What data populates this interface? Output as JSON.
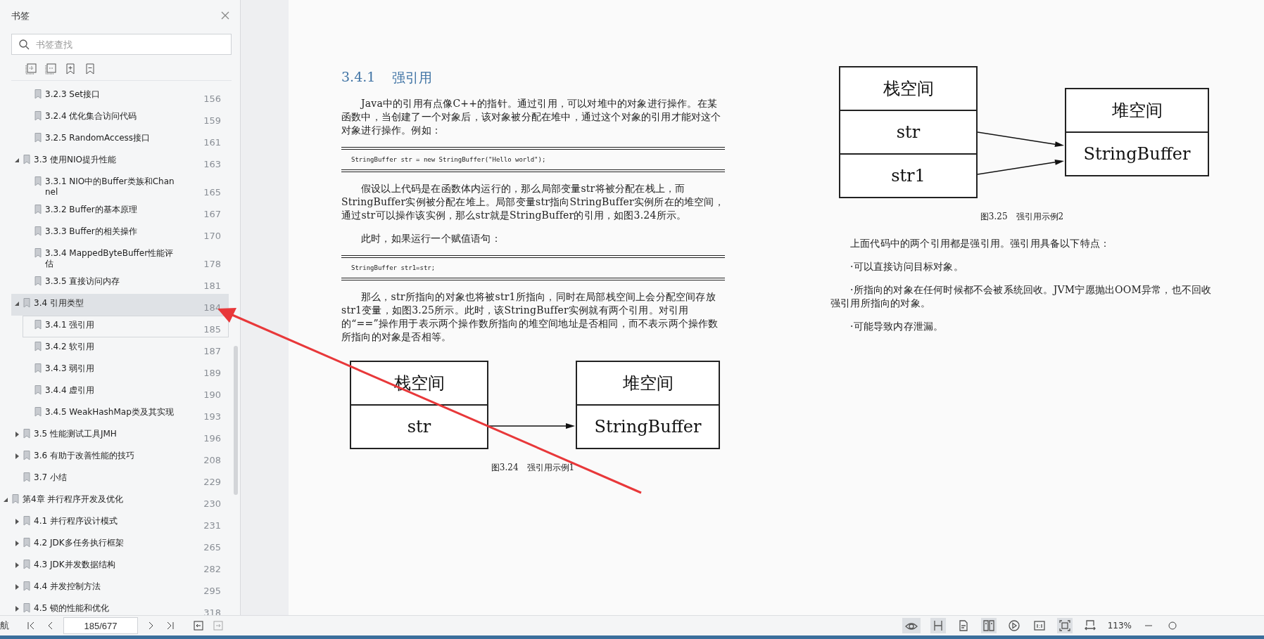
{
  "sidebar": {
    "title": "书签",
    "search": {
      "placeholder": "书签查找"
    },
    "tree": [
      {
        "children": [
          {
            "children": [
              {
                "label": "3.2.3 Set接口",
                "page": "156",
                "selected": false,
                "focused": false
              },
              {
                "label": "3.2.4 优化集合访问代码",
                "page": "159",
                "selected": false,
                "focused": false
              },
              {
                "label": "3.2.5 RandomAccess接口",
                "page": "161",
                "selected": false,
                "focused": false
              }
            ]
          },
          {
            "label": "3.3 使用NIO提升性能",
            "page": "163",
            "expanded": true,
            "selected": false,
            "focused": false,
            "children": [
              {
                "label": "3.3.1 NIO中的Buffer类族和Channel",
                "page": "165",
                "selected": false,
                "focused": false
              },
              {
                "label": "3.3.2 Buffer的基本原理",
                "page": "167",
                "selected": false,
                "focused": false
              },
              {
                "label": "3.3.3 Buffer的相关操作",
                "page": "170",
                "selected": false,
                "focused": false
              },
              {
                "label": "3.3.4 MappedByteBuffer性能评估",
                "page": "178",
                "selected": false,
                "focused": false
              },
              {
                "label": "3.3.5 直接访问内存",
                "page": "181",
                "selected": false,
                "focused": false
              }
            ]
          },
          {
            "label": "3.4 引用类型",
            "page": "184",
            "expanded": true,
            "selected": true,
            "focused": false,
            "children": [
              {
                "label": "3.4.1 强引用",
                "page": "185",
                "selected": false,
                "focused": true
              },
              {
                "label": "3.4.2 软引用",
                "page": "187",
                "selected": false,
                "focused": false
              },
              {
                "label": "3.4.3 弱引用",
                "page": "189",
                "selected": false,
                "focused": false
              },
              {
                "label": "3.4.4 虚引用",
                "page": "190",
                "selected": false,
                "focused": false
              },
              {
                "label": "3.4.5 WeakHashMap类及其实现",
                "page": "193",
                "selected": false,
                "focused": false
              }
            ]
          },
          {
            "label": "3.5 性能测试工具JMH",
            "page": "196",
            "expanded": false,
            "selected": false,
            "focused": false
          },
          {
            "label": "3.6 有助于改善性能的技巧",
            "page": "208",
            "expanded": false,
            "selected": false,
            "focused": false
          },
          {
            "label": "3.7 小结",
            "page": "229",
            "selected": false,
            "focused": false
          }
        ]
      },
      {
        "label": "第4章 并行程序开发及优化",
        "page": "230",
        "expanded": true,
        "selected": false,
        "focused": false,
        "children": [
          {
            "label": "4.1 并行程序设计模式",
            "page": "231",
            "expanded": false,
            "selected": false,
            "focused": false
          },
          {
            "label": "4.2 JDK多任务执行框架",
            "page": "265",
            "expanded": false,
            "selected": false,
            "focused": false
          },
          {
            "label": "4.3 JDK并发数据结构",
            "page": "282",
            "expanded": false,
            "selected": false,
            "focused": false
          },
          {
            "label": "4.4 并发控制方法",
            "page": "295",
            "expanded": false,
            "selected": false,
            "focused": false
          },
          {
            "label": "4.5 锁的性能和优化",
            "page": "318",
            "expanded": false,
            "selected": false,
            "focused": false
          }
        ]
      }
    ]
  },
  "pages": [
    [
      {
        "kind": "heading",
        "number": "3.4.1",
        "text": "强引用"
      },
      {
        "kind": "para",
        "text": "Java中的引用有点像C++的指针。通过引用，可以对堆中的对象进行操作。在某函数中，当创建了一个对象后，该对象被分配在堆中，通过这个对象的引用才能对这个对象进行操作。例如："
      },
      {
        "kind": "code",
        "text": "StringBuffer str = new StringBuffer(\"Hello world\");"
      },
      {
        "kind": "para",
        "text": "假设以上代码是在函数体内运行的，那么局部变量str将被分配在栈上，而StringBuffer实例被分配在堆上。局部变量str指向StringBuffer实例所在的堆空间，通过str可以操作该实例，那么str就是StringBuffer的引用，如图3.24所示。"
      },
      {
        "kind": "para",
        "text": "此时，如果运行一个赋值语句："
      },
      {
        "kind": "code",
        "text": "StringBuffer str1=str;"
      },
      {
        "kind": "para",
        "text": "那么，str所指向的对象也将被str1所指向，同时在局部栈空间上会分配空间存放str1变量，如图3.25所示。此时，该StringBuffer实例就有两个引用。对引用的“==”操作用于表示两个操作数所指向的堆空间地址是否相同，而不表示两个操作数所指向的对象是否相等。"
      },
      {
        "kind": "figure",
        "stack": {
          "title": "栈空间",
          "cells": [
            "str"
          ]
        },
        "heap": {
          "title": "堆空间",
          "cells": [
            "StringBuffer"
          ]
        },
        "caption": "图3.24　强引用示例1"
      }
    ],
    [
      {
        "kind": "figure",
        "stack": {
          "title": "栈空间",
          "cells": [
            "str",
            "str1"
          ]
        },
        "heap": {
          "title": "堆空间",
          "cells": [
            "StringBuffer"
          ]
        },
        "caption": "图3.25　强引用示例2"
      },
      {
        "kind": "para",
        "text": "上面代码中的两个引用都是强引用。强引用具备以下特点："
      },
      {
        "kind": "para",
        "text": "·可以直接访问目标对象。"
      },
      {
        "kind": "para",
        "text": "·所指向的对象在任何时候都不会被系统回收。JVM宁愿抛出OOM异常，也不回收强引用所指向的对象。"
      },
      {
        "kind": "para",
        "text": "·可能导致内存泄漏。"
      }
    ]
  ],
  "status_bar": {
    "label": "航",
    "page_field": "185/677",
    "back_enabled": true,
    "forward_enabled": false,
    "views": [
      {
        "kind": "eye",
        "selected": true
      },
      {
        "kind": "continuous",
        "selected": true
      },
      {
        "kind": "single",
        "selected": false
      },
      {
        "kind": "double",
        "selected": true
      },
      {
        "kind": "play",
        "selected": false
      },
      {
        "kind": "actual",
        "selected": false
      },
      {
        "kind": "fit",
        "selected": true
      },
      {
        "kind": "width",
        "selected": false
      }
    ],
    "zoom": "113%"
  }
}
